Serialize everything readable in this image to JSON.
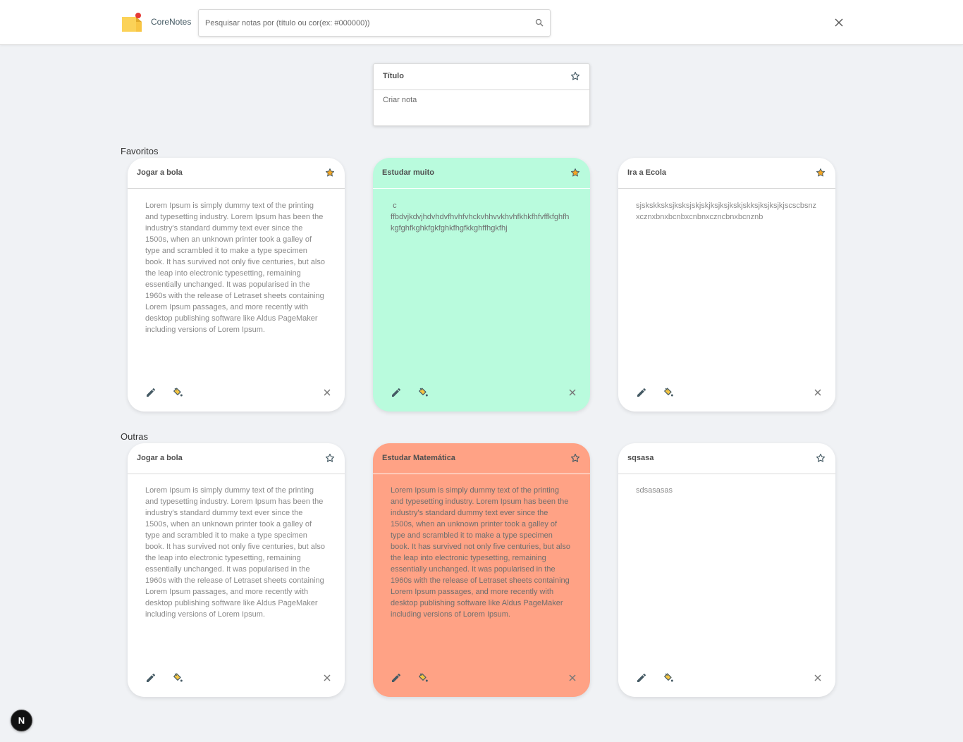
{
  "header": {
    "app_name": "CoreNotes",
    "search": {
      "placeholder": "Pesquisar notas por (título ou cor(ex: #000000))",
      "value": ""
    }
  },
  "create_note": {
    "title_placeholder": "Título",
    "body_placeholder": "Criar nota"
  },
  "sections": {
    "favorites_label": "Favoritos",
    "others_label": "Outras"
  },
  "favorites": [
    {
      "title": "Jogar a bola",
      "body": "Lorem Ipsum is simply dummy text of the printing and typesetting industry. Lorem Ipsum has been the industry's standard dummy text ever since the 1500s, when an unknown printer took a galley of type and scrambled it to make a type specimen book. It has survived not only five centuries, but also the leap into electronic typesetting, remaining essentially unchanged. It was popularised in the 1960s with the release of Letraset sheets containing Lorem Ipsum passages, and more recently with desktop publishing software like Aldus PageMaker including versions of Lorem Ipsum.",
      "color": "#ffffff",
      "favorite": true
    },
    {
      "title": "Estudar muito",
      "body": " c\nffbdvjkdvjhdvhdvfhvhfvhckvhhvvkhvhfkhkfhfvffkfghfhkgfghfkghkfgkfghkfhgfkkghffhgkfhj",
      "color": "#b9fbdd",
      "favorite": true
    },
    {
      "title": "Ira a Ecola",
      "body": "sjskskksksjksksjskjskjksjksjkskjskksjksjksjkjscscbsnzxcznxbnxbcnbxcnbnxczncbnxbcnznb",
      "color": "#ffffff",
      "favorite": true
    }
  ],
  "others": [
    {
      "title": "Jogar a bola",
      "body": "Lorem Ipsum is simply dummy text of the printing and typesetting industry. Lorem Ipsum has been the industry's standard dummy text ever since the 1500s, when an unknown printer took a galley of type and scrambled it to make a type specimen book. It has survived not only five centuries, but also the leap into electronic typesetting, remaining essentially unchanged. It was popularised in the 1960s with the release of Letraset sheets containing Lorem Ipsum passages, and more recently with desktop publishing software like Aldus PageMaker including versions of Lorem Ipsum.",
      "color": "#ffffff",
      "favorite": false
    },
    {
      "title": "Estudar Matemática",
      "body": "Lorem Ipsum is simply dummy text of the printing and typesetting industry. Lorem Ipsum has been the industry's standard dummy text ever since the 1500s, when an unknown printer took a galley of type and scrambled it to make a type specimen book. It has survived not only five centuries, but also the leap into electronic typesetting, remaining essentially unchanged. It was popularised in the 1960s with the release of Letraset sheets containing Lorem Ipsum passages, and more recently with desktop publishing software like Aldus PageMaker including versions of Lorem Ipsum.",
      "color": "#ffa285",
      "favorite": false
    },
    {
      "title": "sqsasa",
      "body": "sdsasasas",
      "color": "#ffffff",
      "favorite": false
    }
  ],
  "icons": {
    "logo": "sticky-note-logo",
    "search": "search-icon",
    "close": "close-icon",
    "star": "star-icon",
    "edit": "pencil-icon",
    "paint": "paint-bucket-icon",
    "delete": "close-icon"
  },
  "colors": {
    "accent_star": "#f5a623",
    "green_note": "#b9fbdd",
    "salmon_note": "#ffa285",
    "background": "#f0f2f5"
  },
  "framework_badge": "N"
}
